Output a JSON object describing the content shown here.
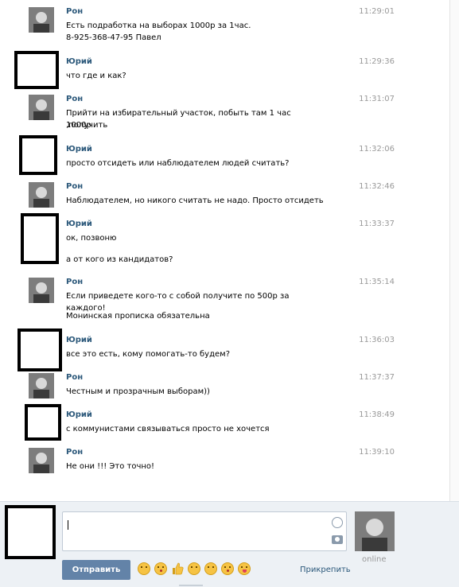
{
  "messages": [
    {
      "author": "Рон",
      "time": "11:29:01",
      "lines": [
        "Есть подработка на выборах 1000р за 1час.",
        "8-925-368-47-95 Павел"
      ],
      "avatar": "photo"
    },
    {
      "author": "Юрий",
      "time": "11:29:36",
      "lines": [
        "что где и как?"
      ],
      "avatar": "black"
    },
    {
      "author": "Рон",
      "time": "11:31:07",
      "lines": [
        "Прийти на избирательный участок, побыть там 1 час ,получить",
        "1000р"
      ],
      "avatar": "photo"
    },
    {
      "author": "Юрий",
      "time": "11:32:06",
      "lines": [
        "просто отсидеть или наблюдателем людей считать?"
      ],
      "avatar": "black"
    },
    {
      "author": "Рон",
      "time": "11:32:46",
      "lines": [
        "Наблюдателем, но никого считать не надо. Просто отсидеть"
      ],
      "avatar": "photo"
    },
    {
      "author": "Юрий",
      "time": "11:33:37",
      "lines": [
        "ок, позвоню",
        "а от кого из кандидатов?"
      ],
      "avatar": "black"
    },
    {
      "author": "Рон",
      "time": "11:35:14",
      "lines": [
        "Если приведете кого-то с собой получите по 500р за каждого!",
        "Монинская прописка обязательна"
      ],
      "avatar": "photo"
    },
    {
      "author": "Юрий",
      "time": "11:36:03",
      "lines": [
        "все это есть, кому помогать-то будем?"
      ],
      "avatar": "black"
    },
    {
      "author": "Рон",
      "time": "11:37:37",
      "lines": [
        "Честным и прозрачным выборам))"
      ],
      "avatar": "photo"
    },
    {
      "author": "Юрий",
      "time": "11:38:49",
      "lines": [
        "с коммунистами связываться просто не хочется"
      ],
      "avatar": "black"
    },
    {
      "author": "Рон",
      "time": "11:39:10",
      "lines": [
        "Не они !!! Это точно!"
      ],
      "avatar": "photo"
    }
  ],
  "composer": {
    "send_label": "Отправить",
    "attach_label": "Прикрепить",
    "status": "online",
    "emoji_icons": [
      "laughing-emoji-icon",
      "kiss-emoji-icon",
      "thumbs-up-icon",
      "wink-emoji-icon",
      "rolling-eyes-emoji-icon",
      "blow-kiss-emoji-icon",
      "grin-emoji-icon"
    ]
  },
  "colors": {
    "author": "#2b587a",
    "time": "#999999",
    "send_button": "#6383a8",
    "composer_bg": "#edf1f5"
  }
}
